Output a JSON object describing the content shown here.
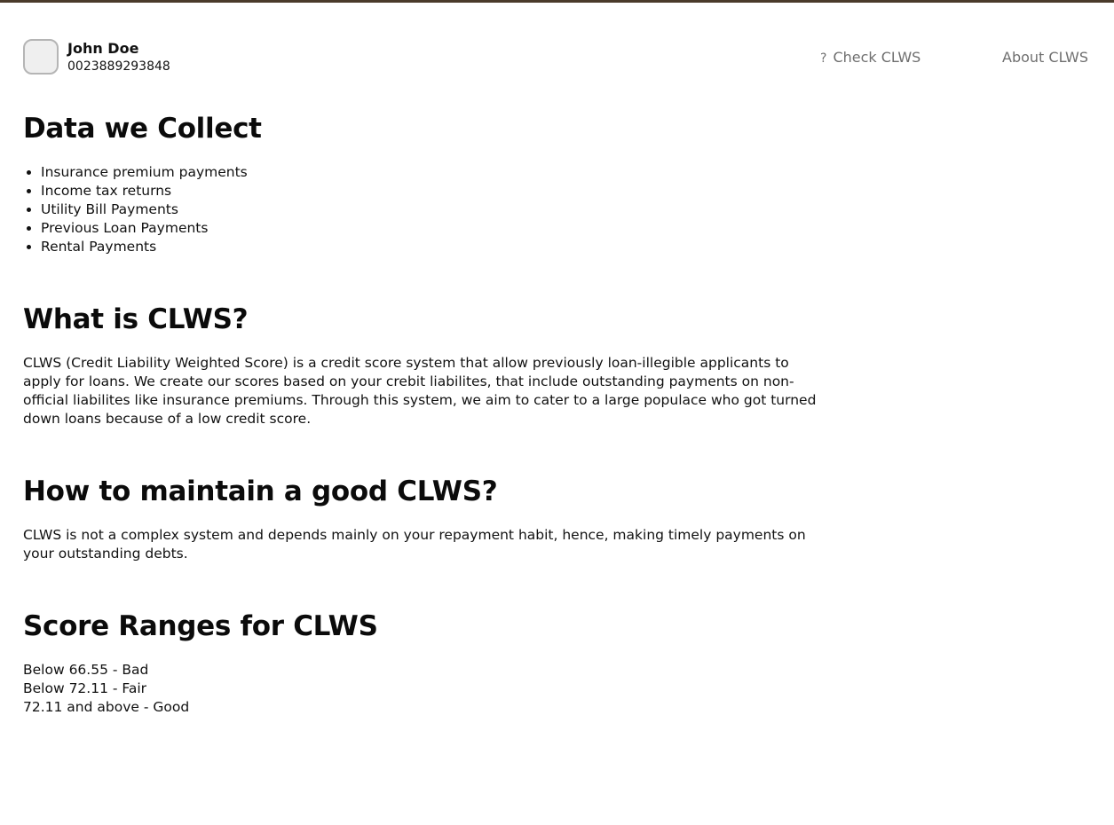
{
  "user": {
    "name": "John Doe",
    "id": "0023889293848"
  },
  "nav": {
    "check_label": "Check CLWS",
    "check_icon": "?",
    "about_label": "About CLWS"
  },
  "sections": {
    "data_collect": {
      "title": "Data we Collect",
      "items": [
        "Insurance premium payments",
        "Income tax returns",
        "Utility Bill Payments",
        "Previous Loan Payments",
        "Rental Payments"
      ]
    },
    "what_is": {
      "title": "What is CLWS?",
      "body": "CLWS (Credit Liability Weighted Score) is a credit score system that allow previously loan-illegible applicants to apply for loans. We create our scores based on your crebit liabilites, that include outstanding payments on non-official liabilites like insurance premiums. Through this system, we aim to cater to a large populace who got turned down loans because of a low credit score."
    },
    "maintain": {
      "title": "How to maintain a good CLWS?",
      "body": "CLWS is not a complex system and depends mainly on your repayment habit, hence, making timely payments on your outstanding debts."
    },
    "ranges": {
      "title": "Score Ranges for CLWS",
      "items": [
        "Below 66.55 - Bad",
        "Below 72.11 - Fair",
        "72.11 and above - Good"
      ]
    }
  }
}
